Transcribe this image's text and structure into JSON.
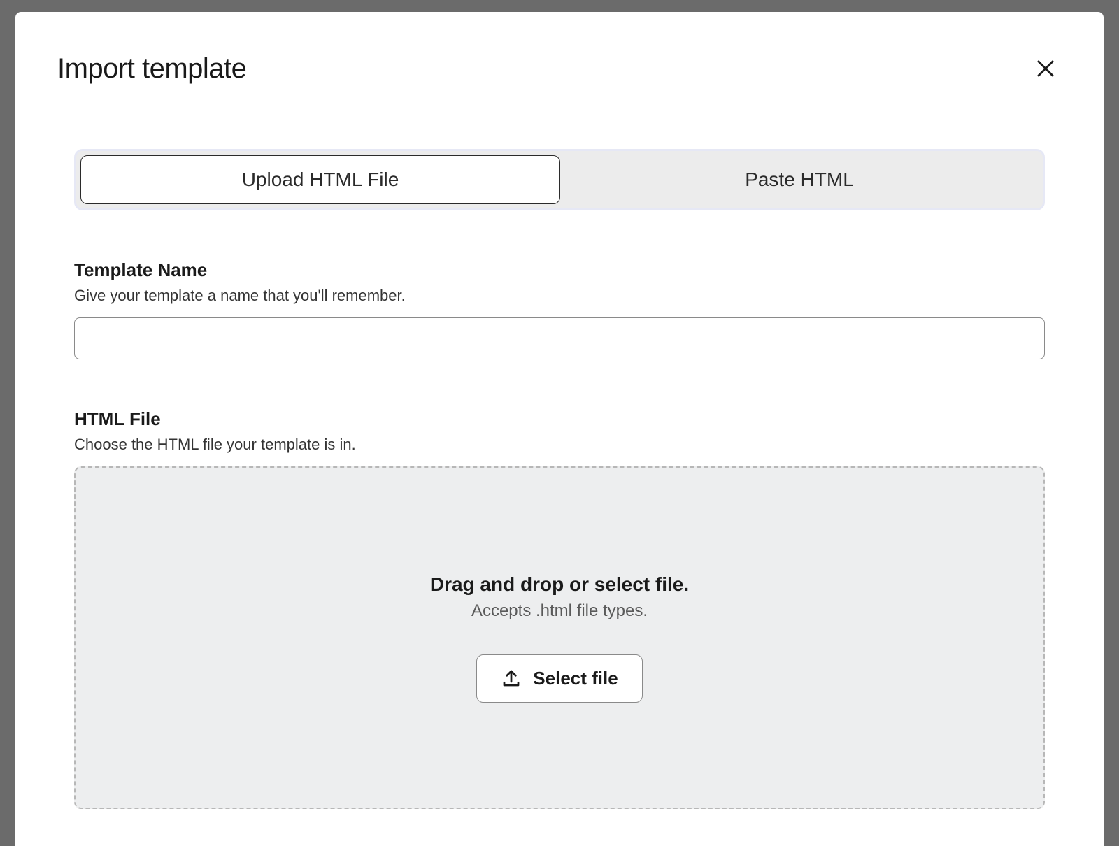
{
  "modal": {
    "title": "Import template",
    "close_aria": "Close"
  },
  "tabs": {
    "upload": "Upload HTML File",
    "paste": "Paste HTML"
  },
  "template_name": {
    "label": "Template Name",
    "help": "Give your template a name that you'll remember.",
    "value": ""
  },
  "html_file": {
    "label": "HTML File",
    "help": "Choose the HTML file your template is in.",
    "drop_title": "Drag and drop or select file.",
    "drop_sub": "Accepts .html file types.",
    "select_button": "Select file"
  }
}
